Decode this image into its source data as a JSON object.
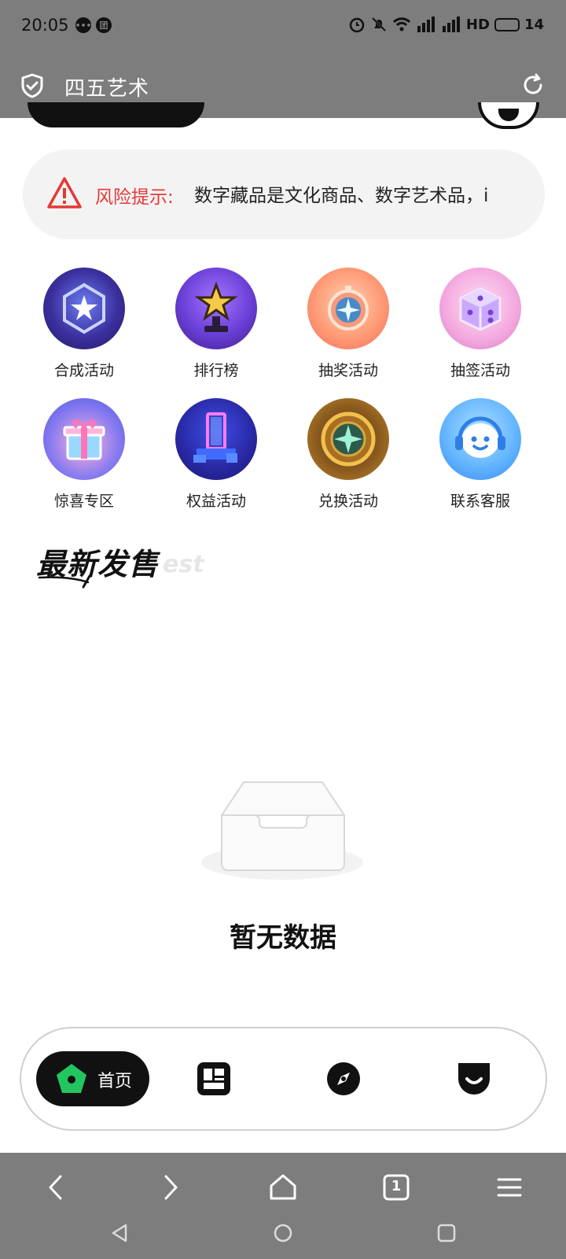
{
  "status_bar": {
    "time": "20:05",
    "left_icons": [
      "message-icon",
      "app-icon"
    ],
    "right_icons": [
      "alarm-icon",
      "mute-icon",
      "wifi-icon",
      "signal-icon",
      "signal-icon",
      "hd-icon"
    ],
    "hd_label": "HD",
    "battery": "14"
  },
  "header": {
    "title": "四五艺术"
  },
  "risk_notice": {
    "label": "风险提示:",
    "text": "数字藏品是文化商品、数字艺术品，i"
  },
  "quick_menu": [
    {
      "label": "合成活动",
      "icon": "synthesis-icon"
    },
    {
      "label": "排行榜",
      "icon": "trophy-icon"
    },
    {
      "label": "抽奖活动",
      "icon": "compass-icon"
    },
    {
      "label": "抽签活动",
      "icon": "dice-icon"
    },
    {
      "label": "惊喜专区",
      "icon": "gift-icon"
    },
    {
      "label": "权益活动",
      "icon": "portal-icon"
    },
    {
      "label": "兑换活动",
      "icon": "medal-icon"
    },
    {
      "label": "联系客服",
      "icon": "headset-icon"
    }
  ],
  "section": {
    "title": "最新发售",
    "subtitle": "est"
  },
  "empty_state": {
    "text": "暂无数据"
  },
  "bottom_nav": {
    "home_label": "首页",
    "items": [
      "home-icon",
      "market-icon",
      "discover-icon",
      "profile-icon"
    ]
  },
  "browser_toolbar": {
    "tab_count": "1"
  },
  "colors": {
    "accent_green": "#22c55e",
    "warning_red": "#e53935",
    "bar_gray": "#7d7d7e"
  }
}
